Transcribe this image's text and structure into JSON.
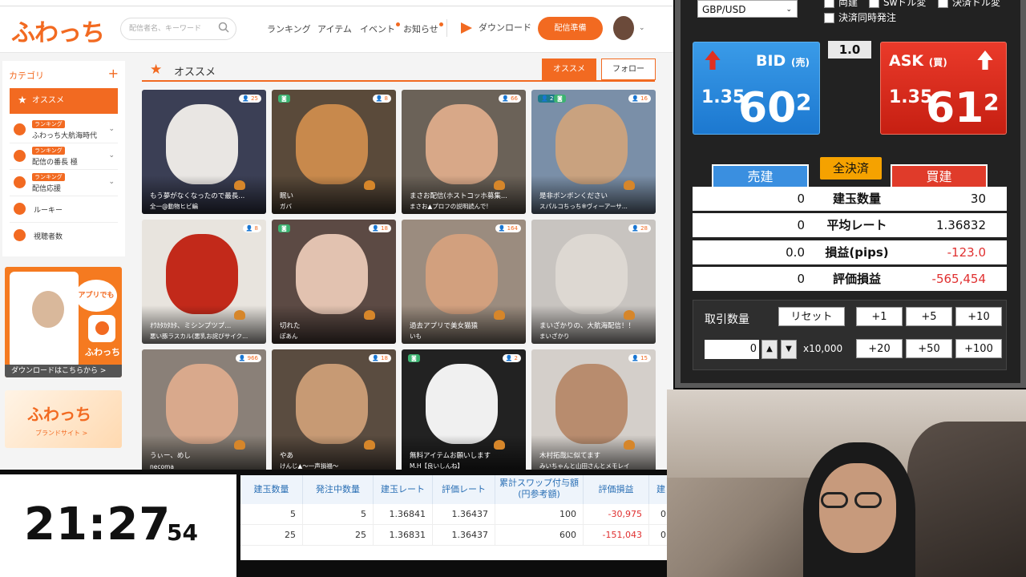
{
  "site": {
    "logo": "ふわっち",
    "search_placeholder": "配信者名、キーワード",
    "nav": [
      "ランキング",
      "アイテム",
      "イベント",
      "お知らせ"
    ],
    "download": "ダウンロード",
    "prepare_button": "配信準備",
    "sidebar": {
      "heading": "カテゴリ",
      "plus": "+",
      "active": "オススメ",
      "items": [
        {
          "badge": "ランキング",
          "label": "ふわっち大航海時代"
        },
        {
          "badge": "ランキング",
          "label": "配信の番長 極"
        },
        {
          "badge": "ランキング",
          "label": "配信応援"
        },
        {
          "badge": "",
          "label": "ルーキー"
        },
        {
          "badge": "",
          "label": "視聴者数"
        }
      ]
    },
    "promo_app": {
      "bubble": "アプリでも",
      "name": "ふわっち",
      "bar": "ダウンロードはこちらから >"
    },
    "promo_brand": {
      "logo": "ふわっち",
      "sub": "ブランドサイト >"
    },
    "section_title": "オススメ",
    "tabs": [
      "オススメ",
      "フォロー"
    ],
    "cards": [
      {
        "count": "25",
        "title": "もう夢がなくなったので最長...",
        "sub": "全一@動物ヒビ編",
        "color": "#3b3f55",
        "skin": "#e9e6e3",
        "tag": ""
      },
      {
        "count": "8",
        "title": "眠い",
        "sub": "ガバ",
        "color": "#5a4a3a",
        "skin": "#c8894c",
        "tag": "cam"
      },
      {
        "count": "66",
        "title": "まさお配信(ホストコッホ募集...",
        "sub": "まさお▲プロフの説明読んで!",
        "color": "#6b6258",
        "skin": "#d8a888",
        "tag": ""
      },
      {
        "count": "16",
        "title": "是非ボンボンください",
        "sub": "スパルコちっち※ヴィーアーサ...",
        "color": "#7a8fa8",
        "skin": "#c9a27f",
        "tag": "grp",
        "group": "2"
      },
      {
        "count": "8",
        "title": "ｵｳｶﾀｶﾀｶﾀ、ミシンプツプ...",
        "sub": "悪い豚ラスカル(悪乳お詫びサイク...",
        "color": "#e8e4de",
        "skin": "#c2291a",
        "tag": ""
      },
      {
        "count": "18",
        "title": "切れた",
        "sub": "ぽあん",
        "color": "#5c4a44",
        "skin": "#e2c2b0",
        "tag": "cam"
      },
      {
        "count": "164",
        "title": "過去アプリで美女猫猿",
        "sub": "いも",
        "color": "#9b8c7f",
        "skin": "#d2a07e",
        "tag": ""
      },
      {
        "count": "28",
        "title": "まいざかりの、大航海配信！！",
        "sub": "まいざかり",
        "color": "#c8c4c0",
        "skin": "#ddd8d2",
        "tag": ""
      },
      {
        "count": "966",
        "title": "うぃー、めし",
        "sub": "necoma",
        "color": "#8a8078",
        "skin": "#d9a98c",
        "tag": ""
      },
      {
        "count": "18",
        "title": "やあ",
        "sub": "けんじ▲〜一声損福〜",
        "color": "#5a4c40",
        "skin": "#c79a74",
        "tag": ""
      },
      {
        "count": "2",
        "title": "無料アイテムお願いします",
        "sub": "M.H【良いしんね】",
        "color": "#222222",
        "skin": "#f0f0f0",
        "tag": "cam"
      },
      {
        "count": "15",
        "title": "木村拓哉に似てます",
        "sub": "みいちゃんと山田さんとメモレイ",
        "color": "#d4cfca",
        "skin": "#b88c6e",
        "tag": ""
      }
    ]
  },
  "clock": {
    "hm": "21:27",
    "sec": "54"
  },
  "positions": {
    "headers": [
      "建玉数量",
      "発注中数量",
      "建玉レート",
      "評価レート",
      "累計スワップ付与額\n(円参考額)",
      "評価損益",
      "建"
    ],
    "rows": [
      [
        "5",
        "5",
        "1.36841",
        "1.36437",
        "100",
        "-30,975",
        "0"
      ],
      [
        "25",
        "25",
        "1.36831",
        "1.36437",
        "600",
        "-151,043",
        "0"
      ]
    ]
  },
  "trade": {
    "pair": "GBP/USD",
    "checkboxes": [
      "両建",
      "Swドル変",
      "決済ドル変",
      "決済同時発注"
    ],
    "spread": "1.0",
    "bid": {
      "label": "BID",
      "tag": "(売)",
      "pre": "1.35",
      "main": "60",
      "sup": "2"
    },
    "ask": {
      "label": "ASK",
      "tag": "(買)",
      "pre": "1.35",
      "main": "61",
      "sup": "2"
    },
    "tabs": {
      "sell": "売建",
      "close": "全決済",
      "buy": "買建"
    },
    "rows": [
      {
        "left": "0",
        "label": "建玉数量",
        "right": "30",
        "neg": false
      },
      {
        "left": "0",
        "label": "平均レート",
        "right": "1.36832",
        "neg": false
      },
      {
        "left": "0.0",
        "label": "損益(pips)",
        "right": "-123.0",
        "neg": true
      },
      {
        "left": "0",
        "label": "評価損益",
        "right": "-565,454",
        "neg": true
      }
    ],
    "qty_label": "取引数量",
    "reset": "リセット",
    "inc1": [
      "+1",
      "+5",
      "+10"
    ],
    "inc2": [
      "+20",
      "+50",
      "+100"
    ],
    "qty_value": "0",
    "multiplier": "x10,000"
  }
}
